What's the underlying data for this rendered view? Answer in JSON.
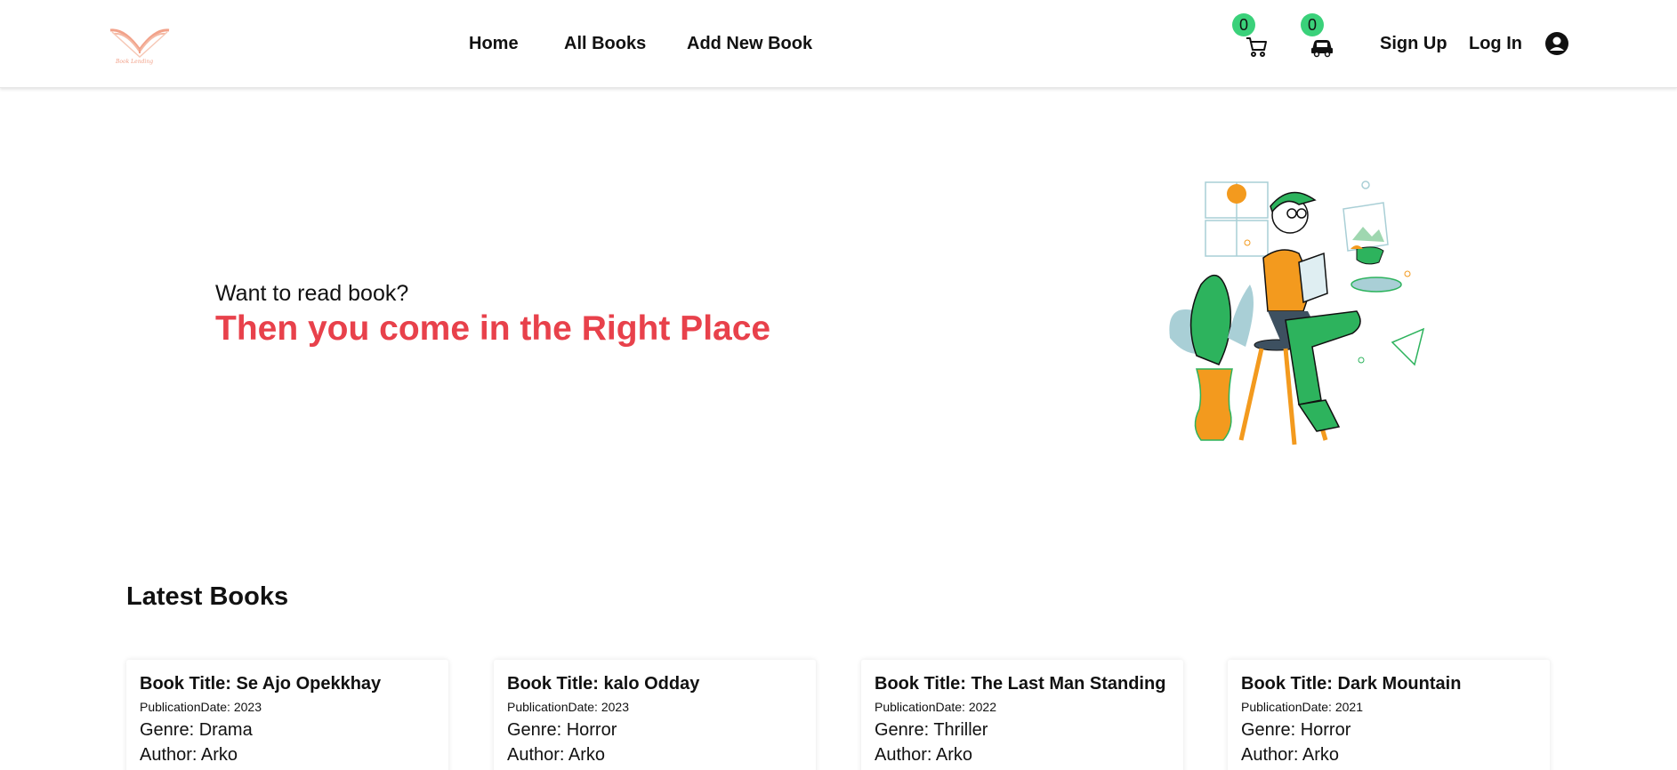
{
  "nav": {
    "links": [
      "Home",
      "All Books",
      "Add New Book"
    ],
    "cart_count": "0",
    "car_count": "0",
    "signup": "Sign Up",
    "login": "Log In",
    "logo_text": "Book Lending"
  },
  "hero": {
    "subtitle": "Want to read book?",
    "title": "Then you come in the Right Place"
  },
  "latest": {
    "heading": "Latest Books",
    "books": [
      {
        "title": "Book Title: Se Ajo Opekkhay",
        "pub": "PublicationDate: 2023",
        "genre": "Genre: Drama",
        "author": "Author: Arko"
      },
      {
        "title": "Book Title: kalo Odday",
        "pub": "PublicationDate: 2023",
        "genre": "Genre: Horror",
        "author": "Author: Arko"
      },
      {
        "title": "Book Title: The Last Man Standing",
        "pub": "PublicationDate: 2022",
        "genre": "Genre: Thriller",
        "author": "Author: Arko"
      },
      {
        "title": "Book Title: Dark Mountain",
        "pub": "PublicationDate: 2021",
        "genre": "Genre: Horror",
        "author": "Author: Arko"
      }
    ]
  },
  "colors": {
    "accent_red": "#e8414b",
    "badge_green": "#3ad17a",
    "illus_green": "#2db35d",
    "illus_orange": "#f39a1e"
  },
  "icons": [
    "book-logo-icon",
    "cart-icon",
    "car-icon",
    "user-circle-icon"
  ]
}
